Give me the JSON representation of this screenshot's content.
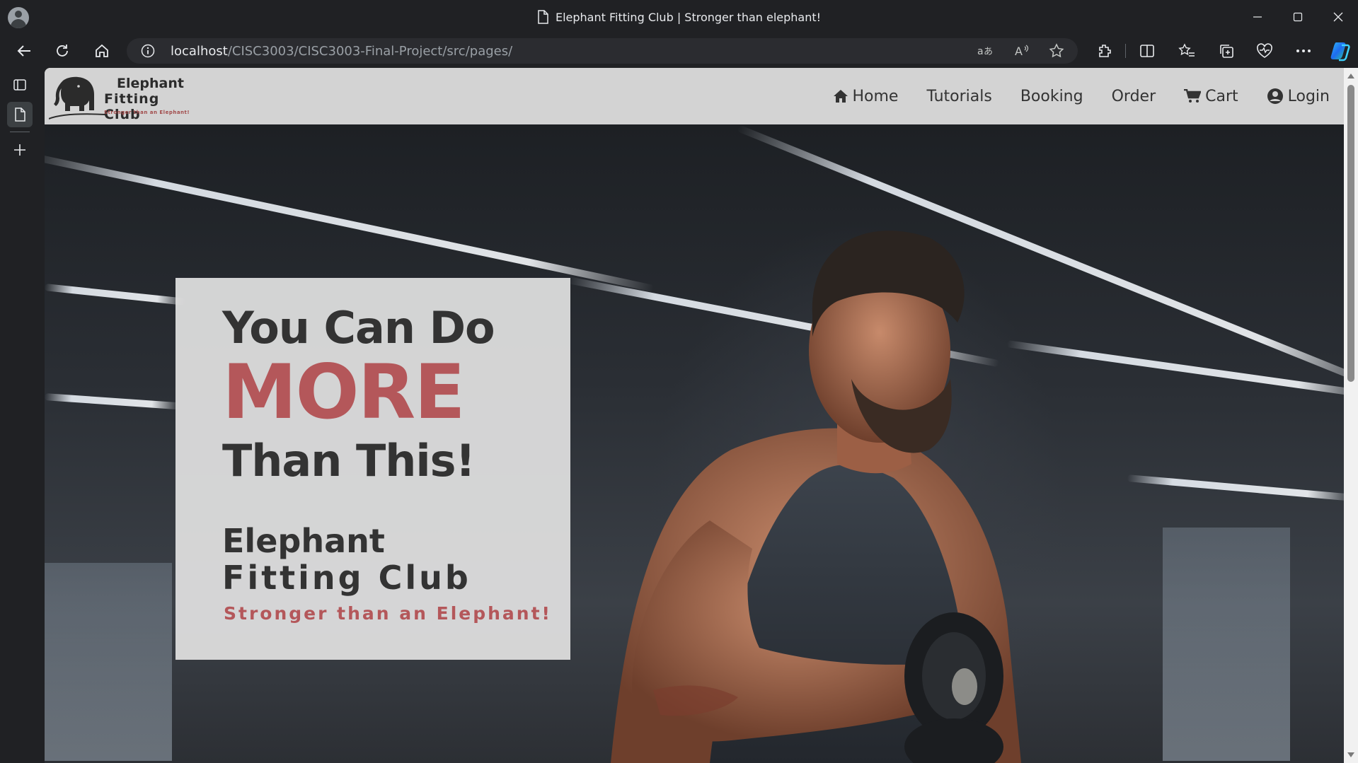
{
  "browser": {
    "tab_title": "Elephant Fitting Club | Stronger than elephant!",
    "url_host": "localhost",
    "url_path": "/CISC3003/CISC3003-Final-Project/src/pages/"
  },
  "site": {
    "logo": {
      "title_line1": "Elephant",
      "title_line2": "Fitting Club",
      "tagline": "Stronger than an Elephant!"
    },
    "nav": [
      {
        "label": "Home",
        "icon": "home-icon"
      },
      {
        "label": "Tutorials",
        "icon": ""
      },
      {
        "label": "Booking",
        "icon": ""
      },
      {
        "label": "Order",
        "icon": ""
      },
      {
        "label": "Cart",
        "icon": "cart-icon"
      },
      {
        "label": "Login",
        "icon": "user-circle-icon"
      }
    ]
  },
  "hero": {
    "line1": "You Can Do",
    "highlight": "MORE",
    "line3": "Than This!",
    "brand_line1": "Elephant",
    "brand_line2": "Fitting Club",
    "tagline": "Stronger than an Elephant!"
  },
  "colors": {
    "accent": "#b4575a",
    "navbar_bg": "#d3d3d3",
    "text_dark": "#333333"
  }
}
